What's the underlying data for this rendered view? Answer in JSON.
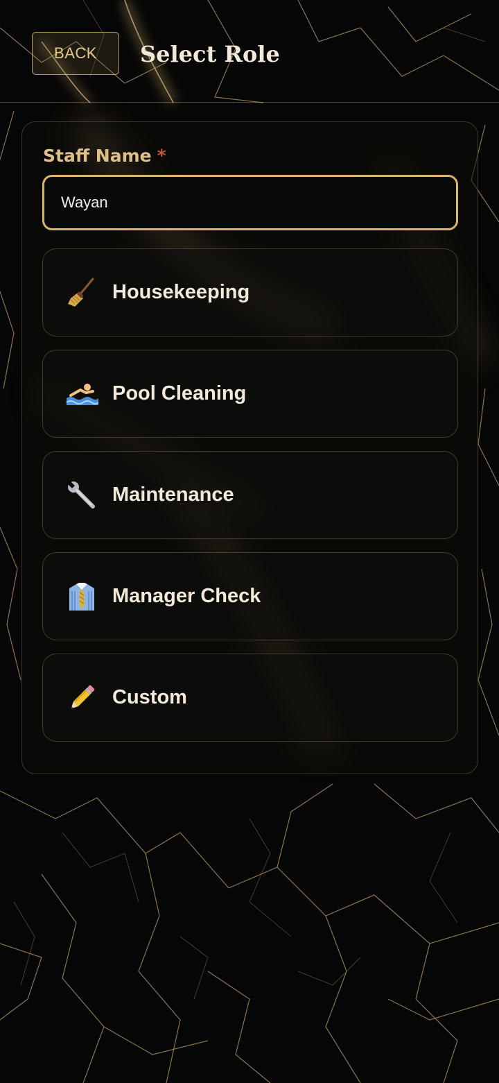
{
  "header": {
    "back_label": "BACK",
    "title": "Select Role"
  },
  "form": {
    "staff_name_label": "Staff Name",
    "required_marker": "*",
    "staff_name_value": "Wayan"
  },
  "roles": [
    {
      "label": "Housekeeping",
      "icon": "broom-icon"
    },
    {
      "label": "Pool Cleaning",
      "icon": "swimmer-icon"
    },
    {
      "label": "Maintenance",
      "icon": "wrench-icon"
    },
    {
      "label": "Manager Check",
      "icon": "shirt-tie-icon"
    },
    {
      "label": "Custom",
      "icon": "pencil-icon"
    }
  ],
  "colors": {
    "accent_gold": "#d9b56d",
    "background": "#050505",
    "required": "#c2563e",
    "text_light": "#f3eadb"
  }
}
